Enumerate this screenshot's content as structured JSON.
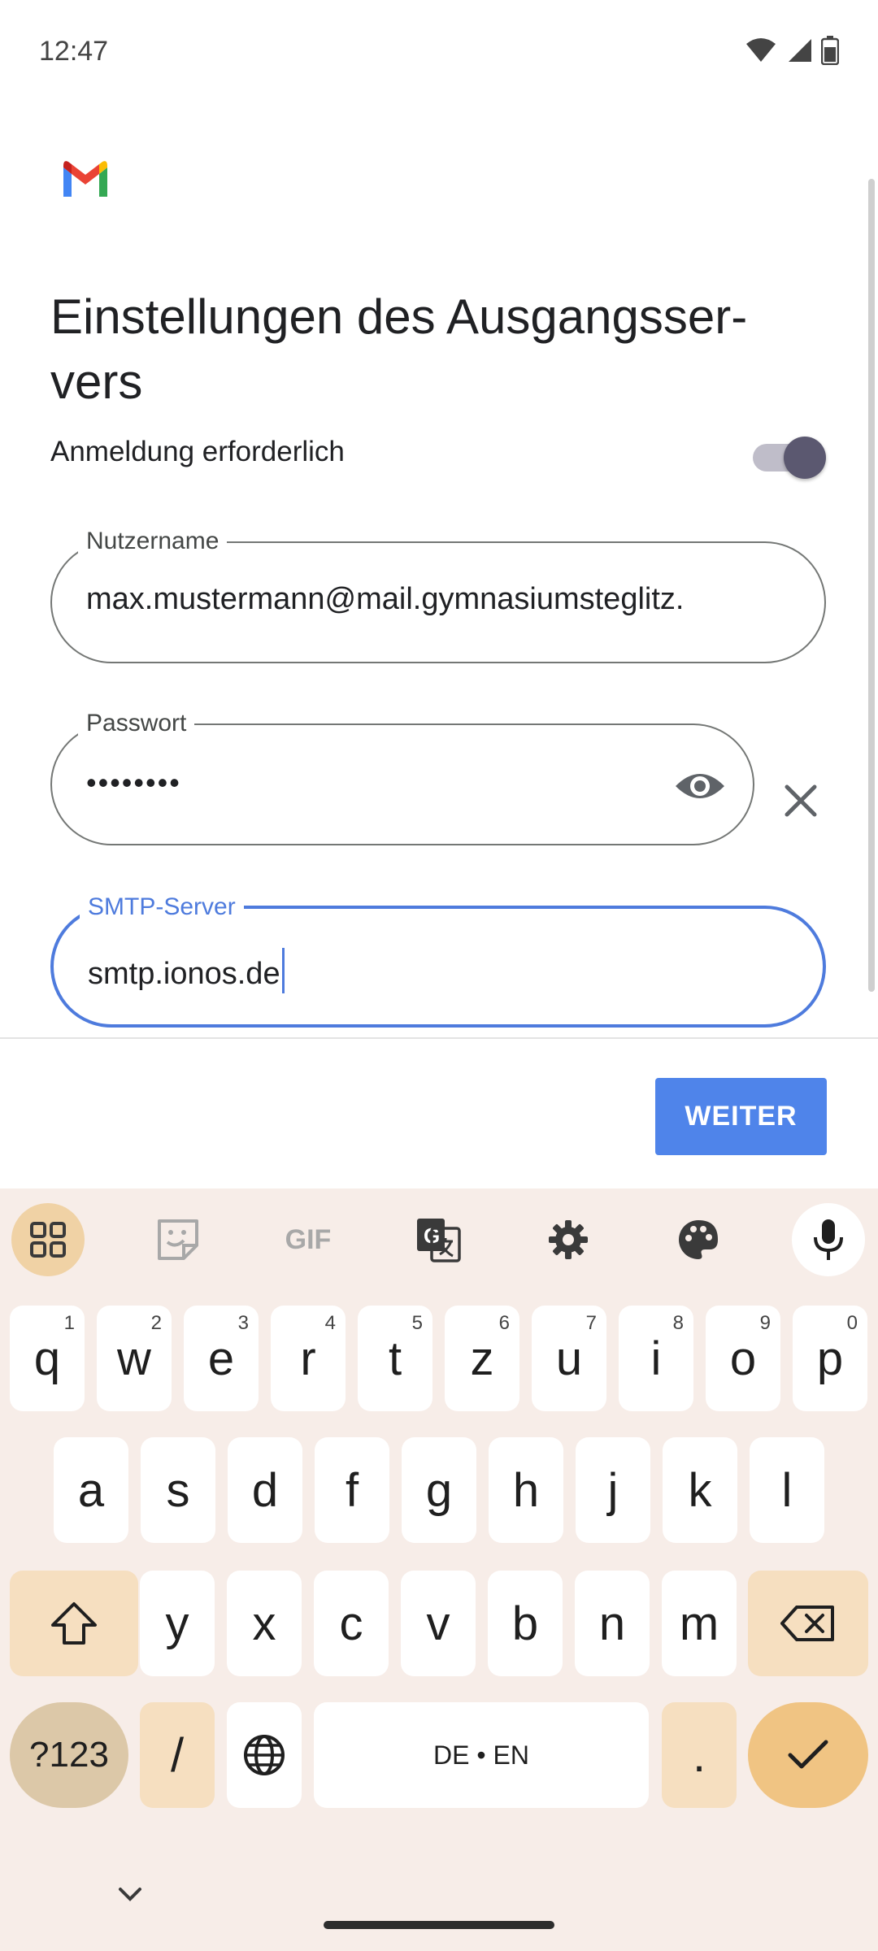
{
  "status": {
    "time": "12:47"
  },
  "page": {
    "title": "Einstellungen des Ausgangsser­vers",
    "title_line1": "Einstellungen des Ausgangsser-",
    "title_line2": "vers"
  },
  "login_required": {
    "label": "Anmeldung erforderlich",
    "enabled": true
  },
  "fields": {
    "username": {
      "label": "Nutzername",
      "value": "max.mustermann@mail.gymnasiumsteglitz."
    },
    "password": {
      "label": "Passwort",
      "value": "••••••••"
    },
    "smtp": {
      "label": "SMTP-Server",
      "value": "smtp.ionos.de"
    }
  },
  "next_button": {
    "label": "WEITER"
  },
  "keyboard": {
    "toolbar": [
      "apps-icon",
      "sticker-icon",
      "gif-icon",
      "translate-icon",
      "settings-icon",
      "palette-icon",
      "mic-icon"
    ],
    "gif_label": "GIF",
    "row1": [
      {
        "k": "q",
        "n": "1"
      },
      {
        "k": "w",
        "n": "2"
      },
      {
        "k": "e",
        "n": "3"
      },
      {
        "k": "r",
        "n": "4"
      },
      {
        "k": "t",
        "n": "5"
      },
      {
        "k": "z",
        "n": "6"
      },
      {
        "k": "u",
        "n": "7"
      },
      {
        "k": "i",
        "n": "8"
      },
      {
        "k": "o",
        "n": "9"
      },
      {
        "k": "p",
        "n": "0"
      }
    ],
    "row2": [
      "a",
      "s",
      "d",
      "f",
      "g",
      "h",
      "j",
      "k",
      "l"
    ],
    "row3": [
      "y",
      "x",
      "c",
      "v",
      "b",
      "n",
      "m"
    ],
    "num_label": "?123",
    "slash_label": "/",
    "space_label": "DE • EN",
    "dot_label": "."
  },
  "colors": {
    "accent": "#4e7bdd",
    "button": "#4f84ea",
    "keyboard_bg": "#f7ede8"
  }
}
